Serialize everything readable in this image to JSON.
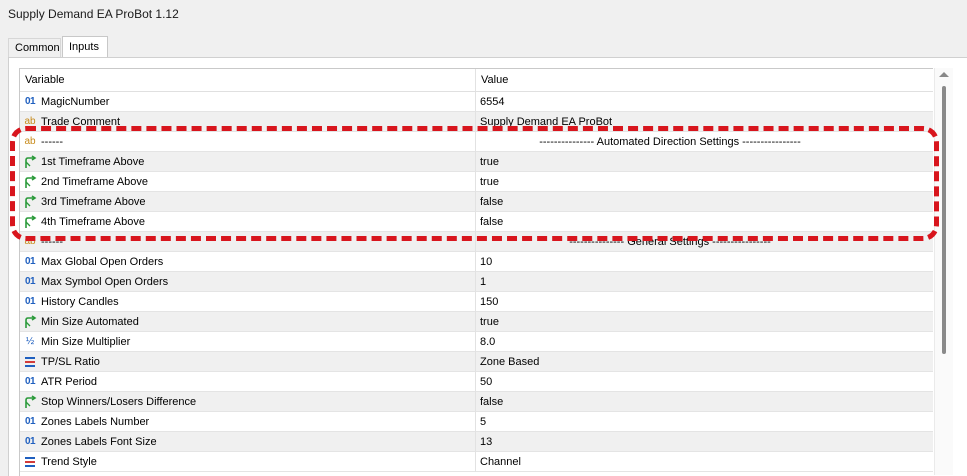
{
  "window": {
    "title": "Supply Demand EA ProBot 1.12"
  },
  "tabs": [
    {
      "label": "Common"
    },
    {
      "label": "Inputs"
    }
  ],
  "table": {
    "header": {
      "variable": "Variable",
      "value": "Value"
    },
    "rows": [
      {
        "icon": "01",
        "icon_name": "integer-icon",
        "variable": "MagicNumber",
        "value": "6554"
      },
      {
        "icon": "ab",
        "icon_name": "string-icon",
        "variable": "Trade Comment",
        "value": "Supply Demand EA ProBot"
      },
      {
        "icon": "ab",
        "icon_name": "string-icon",
        "variable": "------",
        "value": "--------------- Automated Direction Settings ----------------"
      },
      {
        "icon": "bool",
        "icon_name": "bool-arrow-icon",
        "variable": "1st Timeframe Above",
        "value": "true"
      },
      {
        "icon": "bool",
        "icon_name": "bool-arrow-icon",
        "variable": "2nd Timeframe Above",
        "value": "true"
      },
      {
        "icon": "bool",
        "icon_name": "bool-arrow-icon",
        "variable": "3rd Timeframe Above",
        "value": "false"
      },
      {
        "icon": "bool",
        "icon_name": "bool-arrow-icon",
        "variable": "4th Timeframe Above",
        "value": "false"
      },
      {
        "icon": "ab",
        "icon_name": "string-icon",
        "variable": "------",
        "value": "--------------- General Settings ----------------"
      },
      {
        "icon": "01",
        "icon_name": "integer-icon",
        "variable": "Max Global Open Orders",
        "value": "10"
      },
      {
        "icon": "01",
        "icon_name": "integer-icon",
        "variable": "Max Symbol Open Orders",
        "value": "1"
      },
      {
        "icon": "01",
        "icon_name": "integer-icon",
        "variable": "History Candles",
        "value": "150"
      },
      {
        "icon": "bool",
        "icon_name": "bool-arrow-icon",
        "variable": "Min Size Automated",
        "value": "true"
      },
      {
        "icon": "half",
        "icon_name": "double-icon",
        "variable": "Min Size Multiplier",
        "value": "8.0"
      },
      {
        "icon": "enum",
        "icon_name": "enum-icon",
        "variable": "TP/SL Ratio",
        "value": "Zone Based"
      },
      {
        "icon": "01",
        "icon_name": "integer-icon",
        "variable": "ATR Period",
        "value": "50"
      },
      {
        "icon": "bool",
        "icon_name": "bool-arrow-icon",
        "variable": "Stop Winners/Losers Difference",
        "value": "false"
      },
      {
        "icon": "01",
        "icon_name": "integer-icon",
        "variable": "Zones Labels Number",
        "value": "5"
      },
      {
        "icon": "01",
        "icon_name": "integer-icon",
        "variable": "Zones Labels Font Size",
        "value": "13"
      },
      {
        "icon": "enum",
        "icon_name": "enum-icon",
        "variable": "Trend Style",
        "value": "Channel"
      }
    ]
  },
  "colors": {
    "highlight": "#d8151d",
    "int_icon": "#1f5fbf",
    "string_icon": "#c78a1a",
    "bool_icon": "#2a9a3a"
  }
}
